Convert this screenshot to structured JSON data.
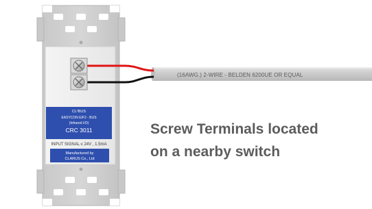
{
  "cable": {
    "label": "(16AWG.) 2-WIRE - BELDEN 6200UE OR EQUAL"
  },
  "device": {
    "cert_mark": "CL²BUS",
    "product_line": "EASYCON E/F2 - BUS",
    "subtitle": "(Infrared I/O)",
    "model": "CRC 3011",
    "input_signal": "INPUT SIGNAL ≤ 24V , 1.5mA",
    "manufacturer_line1": "Manufactured by",
    "manufacturer_line2": "CLARUS Co., Ltd"
  },
  "caption": {
    "line1": "Screw Terminals located",
    "line2": "on a nearby switch"
  },
  "colors": {
    "wire_positive": "#e01515",
    "wire_negative": "#111111",
    "label_blue": "#2f4fae",
    "caption_text": "#5c5c5c"
  }
}
